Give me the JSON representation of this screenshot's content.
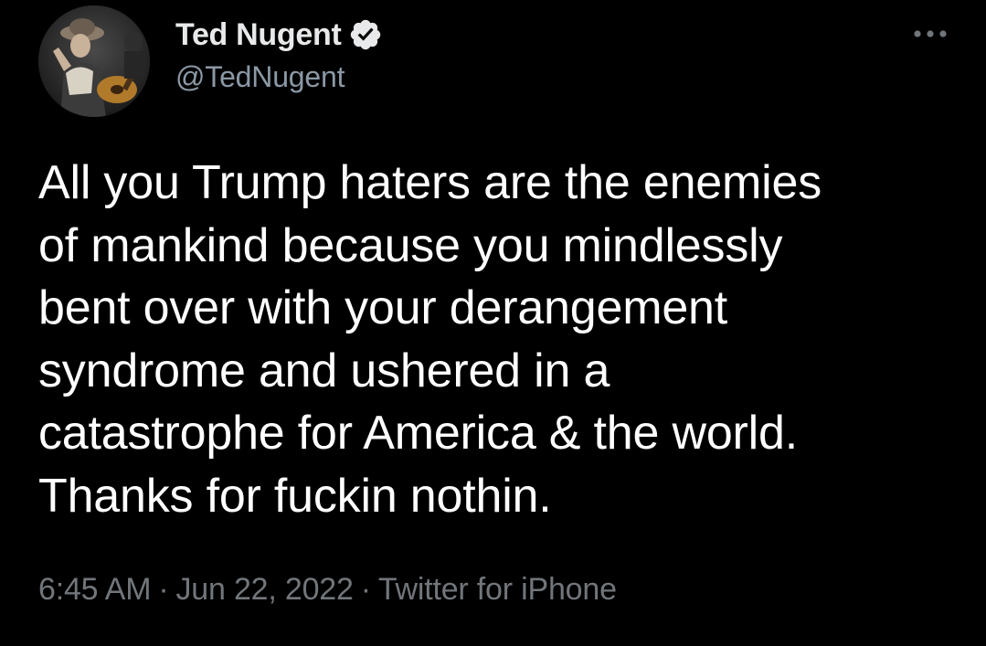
{
  "author": {
    "display_name": "Ted Nugent",
    "handle": "@TedNugent",
    "verified": true,
    "avatar_icon": "profile-photo"
  },
  "tweet": {
    "text_lines": [
      "All you Trump haters are the enemies",
      "of mankind because you mindlessly",
      "bent over with your derangement",
      "syndrome and ushered in a",
      "catastrophe for America & the world.",
      "Thanks for fuckin nothin."
    ]
  },
  "meta": {
    "time": "6:45 AM",
    "separator": "·",
    "date": "Jun 22, 2022",
    "source": "Twitter for iPhone"
  },
  "icons": {
    "more": "more-options-icon",
    "verified": "verified-badge-icon"
  },
  "colors": {
    "background": "#000000",
    "primary_text": "#e7e9ea",
    "secondary_text": "#71767b",
    "handle_text": "#8b98a5"
  }
}
